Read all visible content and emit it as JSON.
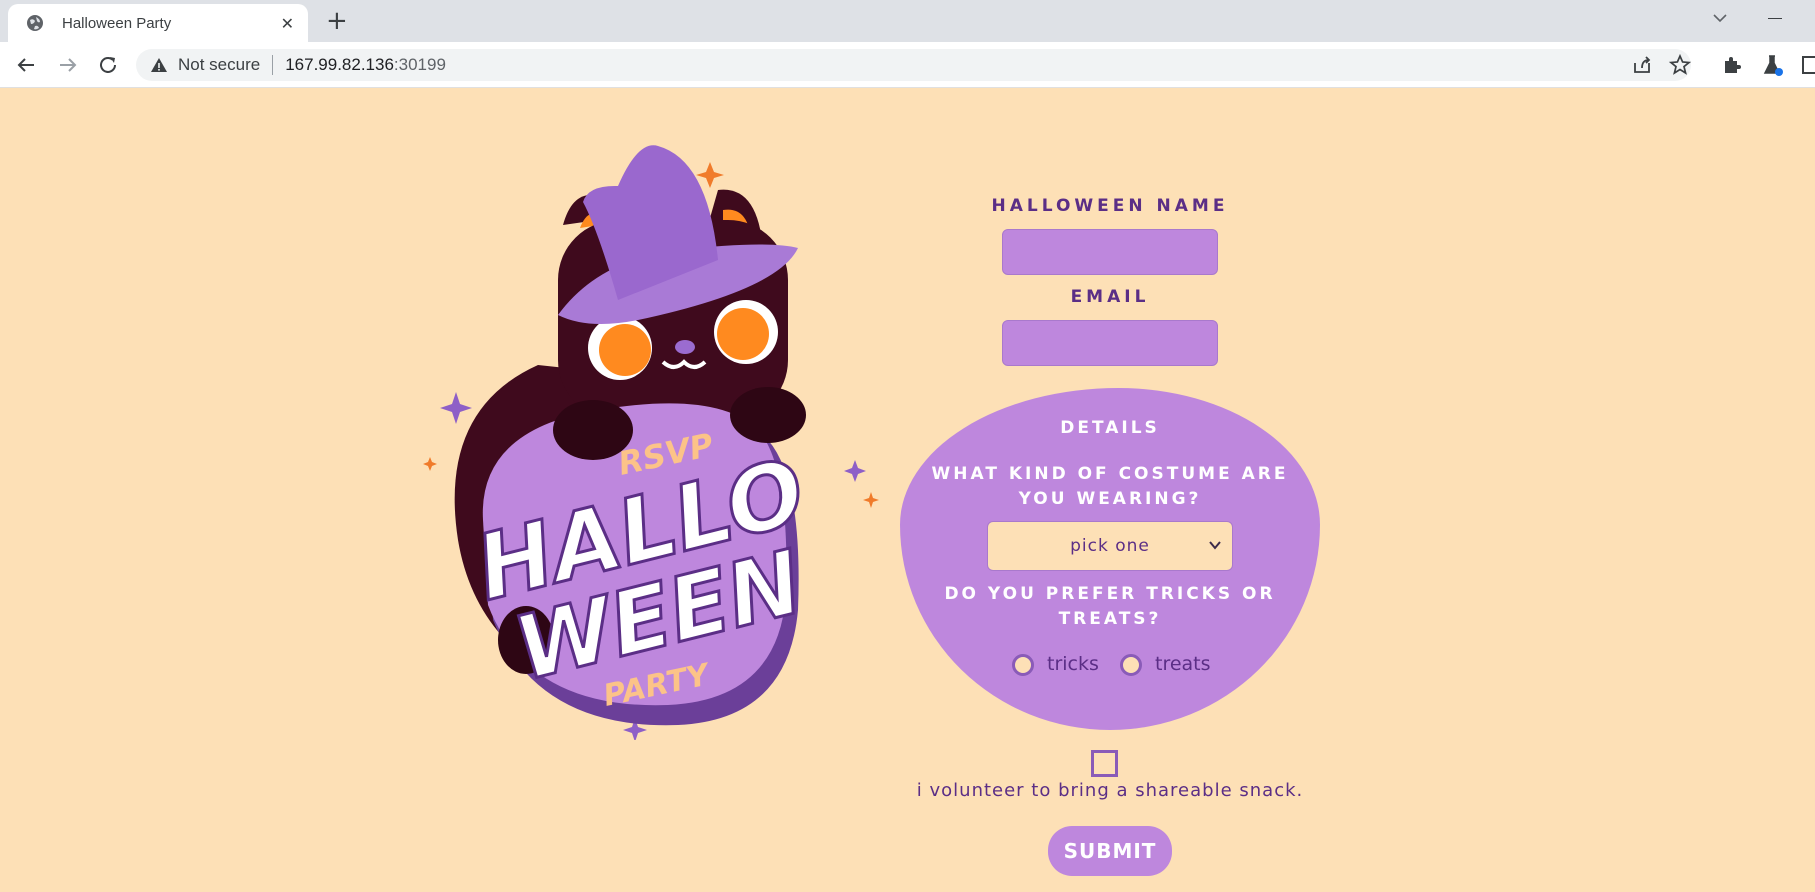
{
  "browser": {
    "tab_title": "Halloween Party",
    "tab_close": "✕",
    "new_tab": "+",
    "security_label": "Not secure",
    "url_host": "167.99.82.136",
    "url_port": ":30199"
  },
  "artwork": {
    "rsvp": "RSVP",
    "line1": "HALLO",
    "line2": "WEEN",
    "party": "PARTY"
  },
  "form": {
    "name_label": "HALLOWEEN NAME",
    "name_value": "",
    "email_label": "EMAIL",
    "email_value": "",
    "details_label": "DETAILS",
    "costume_question_line1": "WHAT KIND OF COSTUME ARE",
    "costume_question_line2": "YOU WEARING?",
    "costume_selected": "pick one",
    "preference_question_line1": "DO YOU PREFER TRICKS OR",
    "preference_question_line2": "TREATS?",
    "option_tricks": "tricks",
    "option_treats": "treats",
    "snack_label": "i volunteer to bring a shareable snack.",
    "submit_label": "SUBMIT"
  },
  "colors": {
    "background": "#fde0b6",
    "accent_purple": "#be87dd",
    "text_purple": "#5b2e86",
    "cat_dark": "#3f0a1d",
    "eye_orange": "#ff8a1f"
  }
}
